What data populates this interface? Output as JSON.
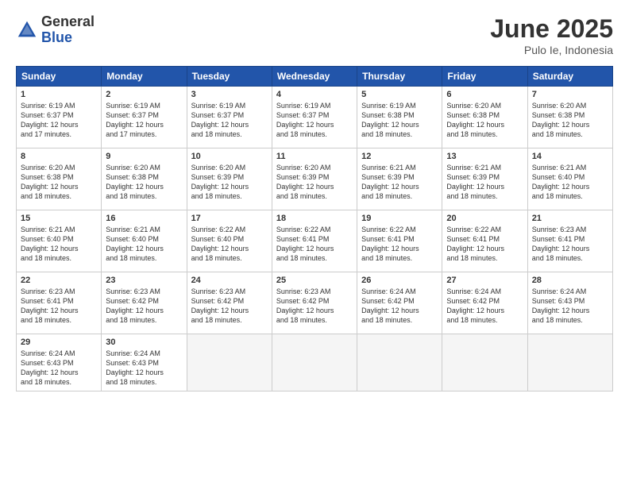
{
  "logo": {
    "general": "General",
    "blue": "Blue"
  },
  "title": "June 2025",
  "location": "Pulo Ie, Indonesia",
  "days_of_week": [
    "Sunday",
    "Monday",
    "Tuesday",
    "Wednesday",
    "Thursday",
    "Friday",
    "Saturday"
  ],
  "weeks": [
    [
      {
        "day": 1,
        "sunrise": "6:19 AM",
        "sunset": "6:37 PM",
        "daylight": "12 hours and 17 minutes."
      },
      {
        "day": 2,
        "sunrise": "6:19 AM",
        "sunset": "6:37 PM",
        "daylight": "12 hours and 17 minutes."
      },
      {
        "day": 3,
        "sunrise": "6:19 AM",
        "sunset": "6:37 PM",
        "daylight": "12 hours and 18 minutes."
      },
      {
        "day": 4,
        "sunrise": "6:19 AM",
        "sunset": "6:37 PM",
        "daylight": "12 hours and 18 minutes."
      },
      {
        "day": 5,
        "sunrise": "6:19 AM",
        "sunset": "6:38 PM",
        "daylight": "12 hours and 18 minutes."
      },
      {
        "day": 6,
        "sunrise": "6:20 AM",
        "sunset": "6:38 PM",
        "daylight": "12 hours and 18 minutes."
      },
      {
        "day": 7,
        "sunrise": "6:20 AM",
        "sunset": "6:38 PM",
        "daylight": "12 hours and 18 minutes."
      }
    ],
    [
      {
        "day": 8,
        "sunrise": "6:20 AM",
        "sunset": "6:38 PM",
        "daylight": "12 hours and 18 minutes."
      },
      {
        "day": 9,
        "sunrise": "6:20 AM",
        "sunset": "6:38 PM",
        "daylight": "12 hours and 18 minutes."
      },
      {
        "day": 10,
        "sunrise": "6:20 AM",
        "sunset": "6:39 PM",
        "daylight": "12 hours and 18 minutes."
      },
      {
        "day": 11,
        "sunrise": "6:20 AM",
        "sunset": "6:39 PM",
        "daylight": "12 hours and 18 minutes."
      },
      {
        "day": 12,
        "sunrise": "6:21 AM",
        "sunset": "6:39 PM",
        "daylight": "12 hours and 18 minutes."
      },
      {
        "day": 13,
        "sunrise": "6:21 AM",
        "sunset": "6:39 PM",
        "daylight": "12 hours and 18 minutes."
      },
      {
        "day": 14,
        "sunrise": "6:21 AM",
        "sunset": "6:40 PM",
        "daylight": "12 hours and 18 minutes."
      }
    ],
    [
      {
        "day": 15,
        "sunrise": "6:21 AM",
        "sunset": "6:40 PM",
        "daylight": "12 hours and 18 minutes."
      },
      {
        "day": 16,
        "sunrise": "6:21 AM",
        "sunset": "6:40 PM",
        "daylight": "12 hours and 18 minutes."
      },
      {
        "day": 17,
        "sunrise": "6:22 AM",
        "sunset": "6:40 PM",
        "daylight": "12 hours and 18 minutes."
      },
      {
        "day": 18,
        "sunrise": "6:22 AM",
        "sunset": "6:41 PM",
        "daylight": "12 hours and 18 minutes."
      },
      {
        "day": 19,
        "sunrise": "6:22 AM",
        "sunset": "6:41 PM",
        "daylight": "12 hours and 18 minutes."
      },
      {
        "day": 20,
        "sunrise": "6:22 AM",
        "sunset": "6:41 PM",
        "daylight": "12 hours and 18 minutes."
      },
      {
        "day": 21,
        "sunrise": "6:23 AM",
        "sunset": "6:41 PM",
        "daylight": "12 hours and 18 minutes."
      }
    ],
    [
      {
        "day": 22,
        "sunrise": "6:23 AM",
        "sunset": "6:41 PM",
        "daylight": "12 hours and 18 minutes."
      },
      {
        "day": 23,
        "sunrise": "6:23 AM",
        "sunset": "6:42 PM",
        "daylight": "12 hours and 18 minutes."
      },
      {
        "day": 24,
        "sunrise": "6:23 AM",
        "sunset": "6:42 PM",
        "daylight": "12 hours and 18 minutes."
      },
      {
        "day": 25,
        "sunrise": "6:23 AM",
        "sunset": "6:42 PM",
        "daylight": "12 hours and 18 minutes."
      },
      {
        "day": 26,
        "sunrise": "6:24 AM",
        "sunset": "6:42 PM",
        "daylight": "12 hours and 18 minutes."
      },
      {
        "day": 27,
        "sunrise": "6:24 AM",
        "sunset": "6:42 PM",
        "daylight": "12 hours and 18 minutes."
      },
      {
        "day": 28,
        "sunrise": "6:24 AM",
        "sunset": "6:43 PM",
        "daylight": "12 hours and 18 minutes."
      }
    ],
    [
      {
        "day": 29,
        "sunrise": "6:24 AM",
        "sunset": "6:43 PM",
        "daylight": "12 hours and 18 minutes."
      },
      {
        "day": 30,
        "sunrise": "6:24 AM",
        "sunset": "6:43 PM",
        "daylight": "12 hours and 18 minutes."
      },
      null,
      null,
      null,
      null,
      null
    ]
  ]
}
